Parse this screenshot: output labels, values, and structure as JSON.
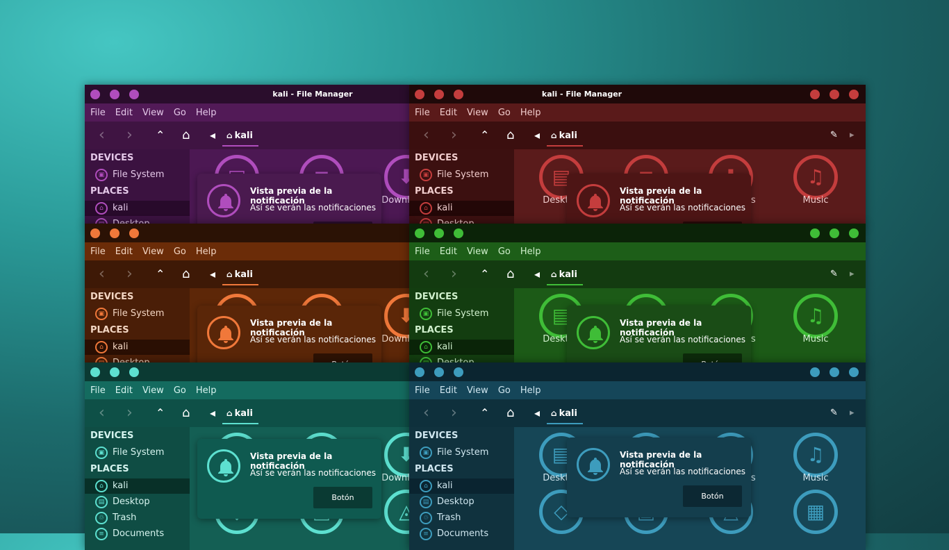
{
  "window_title": "kali - File Manager",
  "menu": [
    "File",
    "Edit",
    "View",
    "Go",
    "Help"
  ],
  "location": "kali",
  "sidebar": {
    "devices_header": "DEVICES",
    "places_header": "PLACES",
    "items": [
      "File System",
      "kali",
      "Desktop",
      "Trash",
      "Documents"
    ]
  },
  "files": [
    "Desktop",
    "Downloads",
    "Music"
  ],
  "notification": {
    "title": "Vista previa de la notificación",
    "body": "Así se verán las notificaciones",
    "button": "Botón"
  },
  "themes": [
    {
      "name": "purple",
      "title_bg": "#2a0d2c",
      "menu_bg": "#521a57",
      "tool_bg": "#3f1442",
      "side_bg": "#3b1240",
      "main_bg": "#4c1853",
      "sel_bg": "#280a2b",
      "accent": "#b04dbd",
      "note_bg": "#4a1a4f",
      "btn_bg": "#2c0e2f",
      "fg": "#e4c8e8"
    },
    {
      "name": "red",
      "title_bg": "#1f0909",
      "menu_bg": "#5a1a1a",
      "tool_bg": "#3b0f0f",
      "side_bg": "#3c1010",
      "main_bg": "#5a1b1b",
      "sel_bg": "#230707",
      "accent": "#c43d3d",
      "note_bg": "#4d1515",
      "btn_bg": "#2b0a0a",
      "fg": "#f0cccc"
    },
    {
      "name": "orange",
      "title_bg": "#2b1205",
      "menu_bg": "#6b2c08",
      "tool_bg": "#3e1906",
      "side_bg": "#4a1e07",
      "main_bg": "#5d2708",
      "sel_bg": "#2a0f03",
      "accent": "#f0783a",
      "note_bg": "#5a2608",
      "btn_bg": "#2d1204",
      "fg": "#f3d6c3"
    },
    {
      "name": "green",
      "title_bg": "#0b2308",
      "menu_bg": "#1d5e18",
      "tool_bg": "#133b10",
      "side_bg": "#133d10",
      "main_bg": "#1c5a17",
      "sel_bg": "#0a2408",
      "accent": "#3fbd37",
      "note_bg": "#1a4c16",
      "btn_bg": "#0d2a0b",
      "fg": "#d0f0cd"
    },
    {
      "name": "teal",
      "title_bg": "#0b3a33",
      "menu_bg": "#146b5f",
      "tool_bg": "#0e5047",
      "side_bg": "#0f4d44",
      "main_bg": "#145f54",
      "sel_bg": "#083028",
      "accent": "#5de0d0",
      "note_bg": "#0f5a50",
      "btn_bg": "#0a3a33",
      "fg": "#d6f4ef"
    },
    {
      "name": "blue",
      "title_bg": "#0b2530",
      "menu_bg": "#154659",
      "tool_bg": "#0e303c",
      "side_bg": "#10323e",
      "main_bg": "#164656",
      "sel_bg": "#0a2430",
      "accent": "#3d9cbd",
      "note_bg": "#143e4d",
      "btn_bg": "#0c2833",
      "fg": "#cfe6ef"
    }
  ],
  "icons": {
    "back": "chevron-left-icon",
    "forward": "chevron-right-icon",
    "up": "chevron-up-icon",
    "home": "home-icon",
    "edit": "pencil-icon",
    "bell": "bell-icon"
  }
}
